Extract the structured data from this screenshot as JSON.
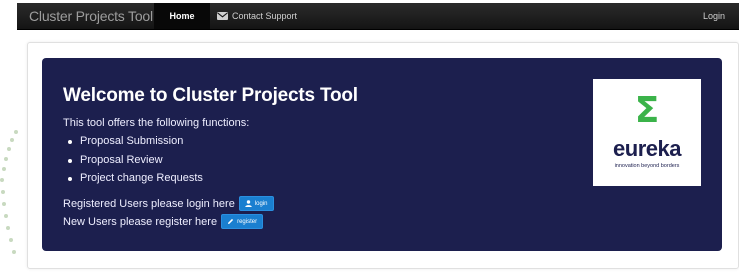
{
  "navbar": {
    "brand": "Cluster Projects Tool",
    "home_label": "Home",
    "support_label": "Contact Support",
    "login_label": "Login"
  },
  "hero": {
    "title": "Welcome to Cluster Projects Tool",
    "intro": "This tool offers the following functions:",
    "functions": [
      "Proposal Submission",
      "Proposal Review",
      "Project change Requests"
    ],
    "registered_text": "Registered Users please login here",
    "login_button": "login",
    "new_users_text": "New Users please register here",
    "register_button": "register"
  },
  "logo": {
    "symbol": "Σ",
    "wordmark": "eureka",
    "tagline": "innovation beyond borders"
  },
  "colors": {
    "navbar_bg": "#1a1a1a",
    "hero_bg": "#1c1f4e",
    "button_blue": "#1a7fd0",
    "logo_green": "#3bb34a"
  },
  "icons": {
    "support": "envelope-icon",
    "login_button": "user-icon",
    "register_button": "pencil-icon"
  }
}
